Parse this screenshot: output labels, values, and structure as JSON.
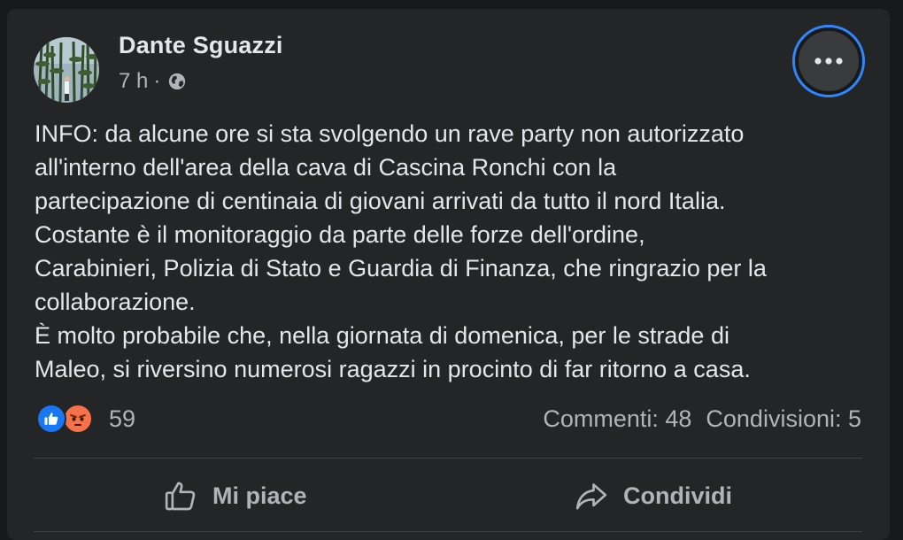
{
  "post": {
    "author": "Dante Sguazzi",
    "time": "7 h",
    "separator": "·",
    "privacy_icon": "globe-icon",
    "more_icon": "more-options-icon",
    "text_lines": [
      "INFO: da alcune ore si sta svolgendo un rave party non autorizzato",
      "all'interno dell'area della cava di Cascina Ronchi con la",
      "partecipazione di centinaia di giovani arrivati da tutto il nord Italia.",
      "Costante è il monitoraggio da parte delle forze dell'ordine,",
      "Carabinieri, Polizia di Stato e Guardia di Finanza, che ringrazio per la",
      "collaborazione.",
      "È molto probabile che, nella giornata di domenica, per le strade di",
      "Maleo, si riversino numerosi ragazzi in procinto di far ritorno a casa."
    ]
  },
  "reactions": {
    "icons": [
      "like-reaction-icon",
      "angry-reaction-icon"
    ],
    "count": "59"
  },
  "stats": {
    "comments": "Commenti: 48",
    "shares": "Condivisioni: 5"
  },
  "actions": {
    "like_label": "Mi piace",
    "share_label": "Condividi"
  },
  "colors": {
    "background": "#18191a",
    "card": "#242526",
    "accent": "#2d88ff",
    "like": "#1877f2",
    "angry": "#f7714b",
    "primary_text": "#e4e6eb",
    "secondary_text": "#b0b3b8"
  }
}
